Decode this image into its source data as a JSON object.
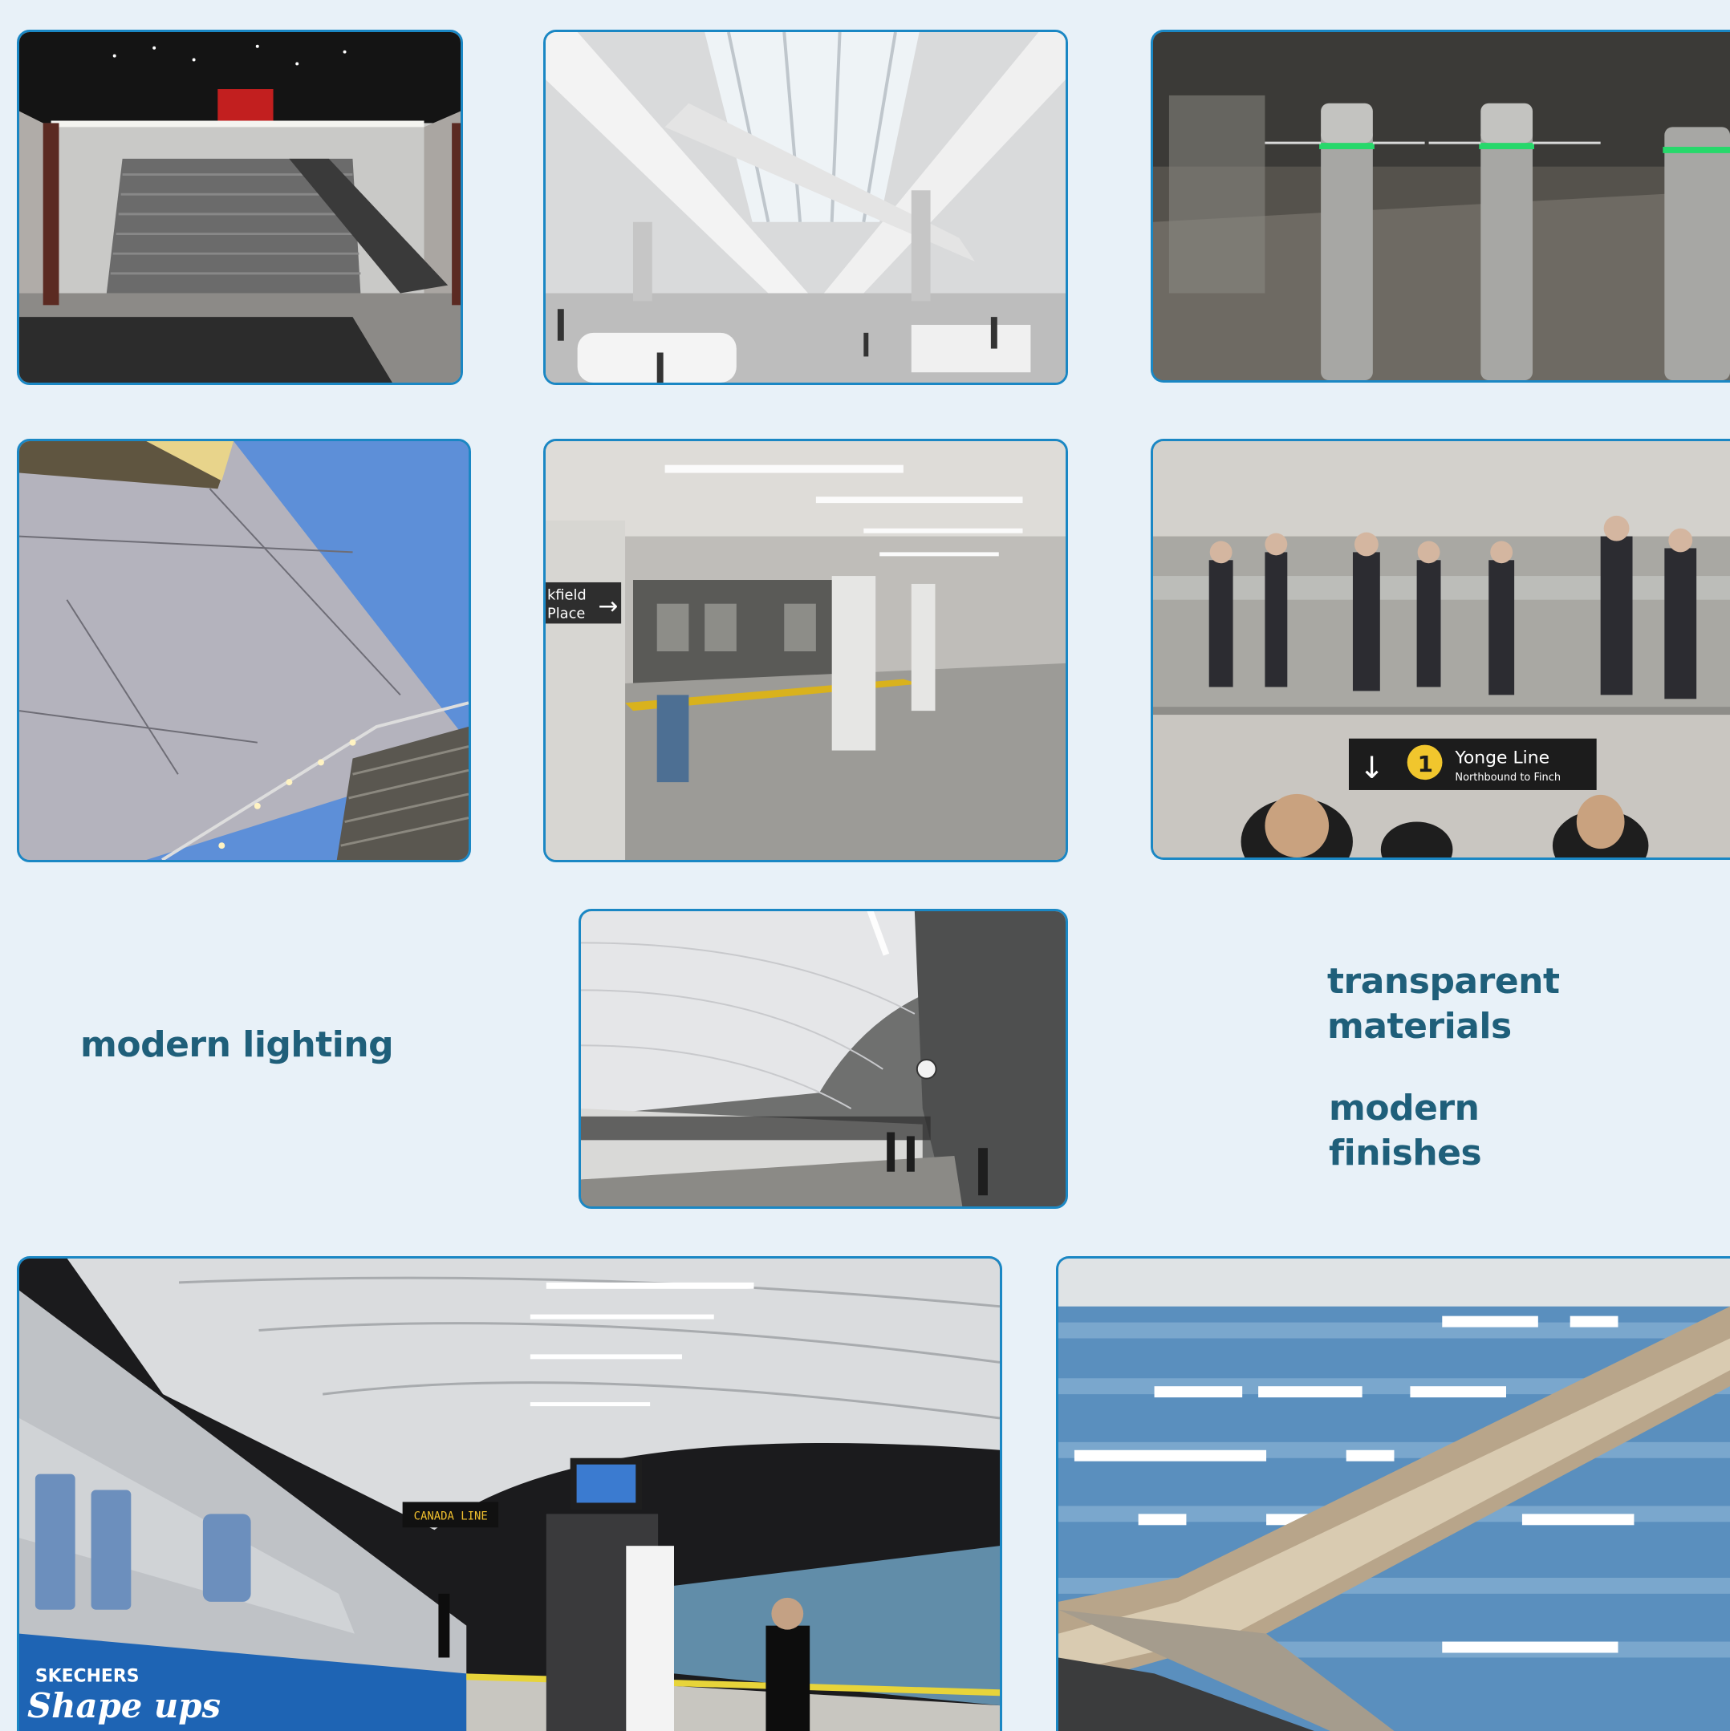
{
  "captions": {
    "modern_lighting": "modern lighting",
    "transparent_materials": [
      "transparent",
      "materials"
    ],
    "modern_finishes": [
      "modern",
      "finishes"
    ]
  },
  "photo_signage": {
    "platform_sign": [
      "kfield",
      "Place"
    ],
    "line_sign_number": "1",
    "line_sign_name": "Yonge Line",
    "line_sign_direction": "Northbound to Finch",
    "train_ad_brand": "SKECHERS",
    "train_ad_slogan": "Shape ups",
    "platform_display": "CANADA LINE"
  },
  "colors": {
    "background": "#e8f1f8",
    "photo_border": "#1a87c4",
    "caption_text": "#1f5f7a"
  }
}
